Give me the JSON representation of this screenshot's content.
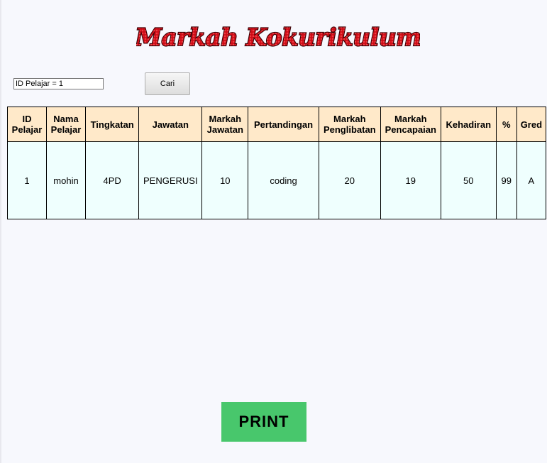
{
  "header": {
    "title": "Markah Kokurikulum"
  },
  "search": {
    "value": "ID Pelajar = 1",
    "button_label": "Cari"
  },
  "table": {
    "columns": [
      "ID Pelajar",
      "Nama Pelajar",
      "Tingkatan",
      "Jawatan",
      "Markah Jawatan",
      "Pertandingan",
      "Markah Penglibatan",
      "Markah Pencapaian",
      "Kehadiran",
      "%",
      "Gred"
    ],
    "rows": [
      [
        "1",
        "mohin",
        "4PD",
        "PENGERUSI",
        "10",
        "coding",
        "20",
        "19",
        "50",
        "99",
        "A"
      ]
    ]
  },
  "actions": {
    "print_label": "PRINT"
  },
  "colors": {
    "title_red": "#d8111b",
    "header_bg": "#ffe9c9",
    "cell_bg": "#effffe",
    "print_bg": "#48c76c",
    "page_bg": "#f7f8fd"
  }
}
